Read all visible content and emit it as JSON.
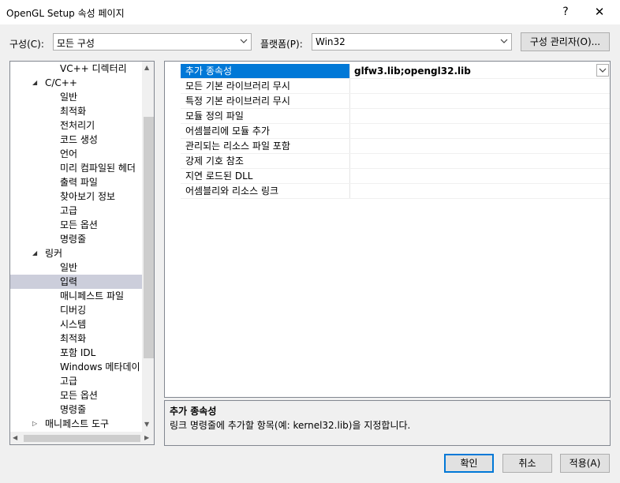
{
  "window": {
    "title": "OpenGL Setup 속성 페이지",
    "help_label": "?",
    "close_label": "✕"
  },
  "config_bar": {
    "config_label": "구성(C):",
    "config_value": "모든 구성",
    "platform_label": "플랫폼(P):",
    "platform_value": "Win32",
    "manager_label": "구성 관리자(O)..."
  },
  "tree": {
    "items": [
      {
        "label": "VC++ 디렉터리",
        "level": 2,
        "expander": ""
      },
      {
        "label": "C/C++",
        "level": 1,
        "expander": "◢"
      },
      {
        "label": "일반",
        "level": 2,
        "expander": ""
      },
      {
        "label": "최적화",
        "level": 2,
        "expander": ""
      },
      {
        "label": "전처리기",
        "level": 2,
        "expander": ""
      },
      {
        "label": "코드 생성",
        "level": 2,
        "expander": ""
      },
      {
        "label": "언어",
        "level": 2,
        "expander": ""
      },
      {
        "label": "미리 컴파일된 헤더",
        "level": 2,
        "expander": ""
      },
      {
        "label": "출력 파일",
        "level": 2,
        "expander": ""
      },
      {
        "label": "찾아보기 정보",
        "level": 2,
        "expander": ""
      },
      {
        "label": "고급",
        "level": 2,
        "expander": ""
      },
      {
        "label": "모든 옵션",
        "level": 2,
        "expander": ""
      },
      {
        "label": "명령줄",
        "level": 2,
        "expander": ""
      },
      {
        "label": "링커",
        "level": 1,
        "expander": "◢"
      },
      {
        "label": "일반",
        "level": 2,
        "expander": ""
      },
      {
        "label": "입력",
        "level": 2,
        "expander": "",
        "selected": true
      },
      {
        "label": "매니페스트 파일",
        "level": 2,
        "expander": ""
      },
      {
        "label": "디버깅",
        "level": 2,
        "expander": ""
      },
      {
        "label": "시스템",
        "level": 2,
        "expander": ""
      },
      {
        "label": "최적화",
        "level": 2,
        "expander": ""
      },
      {
        "label": "포함 IDL",
        "level": 2,
        "expander": ""
      },
      {
        "label": "Windows 메타데이",
        "level": 2,
        "expander": ""
      },
      {
        "label": "고급",
        "level": 2,
        "expander": ""
      },
      {
        "label": "모든 옵션",
        "level": 2,
        "expander": ""
      },
      {
        "label": "명령줄",
        "level": 2,
        "expander": ""
      },
      {
        "label": "매니페스트 도구",
        "level": 1,
        "expander": "▷"
      }
    ],
    "scroll_up": "▲",
    "scroll_down": "▼",
    "scroll_left": "◀",
    "scroll_right": "▶"
  },
  "properties": {
    "rows": [
      {
        "name": "추가 종속성",
        "value": "glfw3.lib;opengl32.lib",
        "selected": true
      },
      {
        "name": "모든 기본 라이브러리 무시",
        "value": ""
      },
      {
        "name": "특정 기본 라이브러리 무시",
        "value": ""
      },
      {
        "name": "모듈 정의 파일",
        "value": ""
      },
      {
        "name": "어셈블리에 모듈 추가",
        "value": ""
      },
      {
        "name": "관리되는 리소스 파일 포함",
        "value": ""
      },
      {
        "name": "강제 기호 참조",
        "value": ""
      },
      {
        "name": "지연 로드된 DLL",
        "value": ""
      },
      {
        "name": "어셈블리와 리소스 링크",
        "value": ""
      }
    ],
    "dropdown_glyph": "⌵"
  },
  "description": {
    "title": "추가 종속성",
    "text": "링크 명령줄에 추가할 항목(예: kernel32.lib)을 지정합니다."
  },
  "buttons": {
    "ok": "확인",
    "cancel": "취소",
    "apply": "적용(A)"
  },
  "colors": {
    "selection": "#0078d7",
    "tree_selection": "#cccedb"
  }
}
